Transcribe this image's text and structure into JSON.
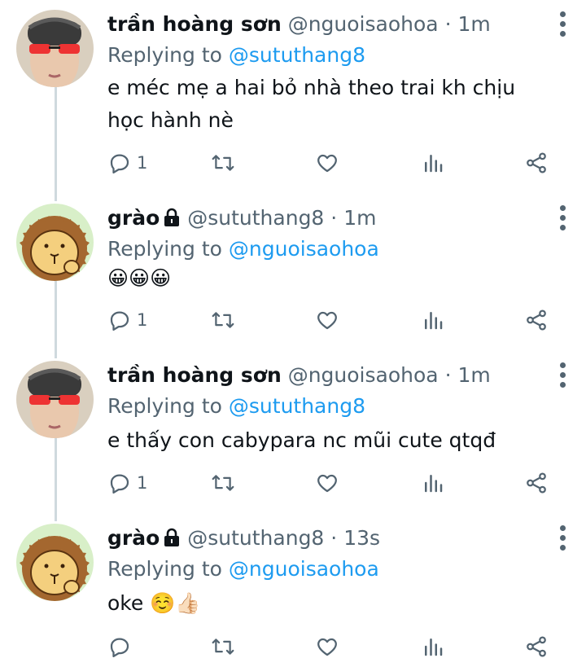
{
  "tweets": [
    {
      "name": "trần hoàng sơn",
      "handle": "@nguoisaohoa",
      "time": "1m",
      "locked": false,
      "reply_prefix": "Replying to ",
      "reply_to": "@sututhang8",
      "text": "e méc mẹ a hai bỏ nhà theo trai kh chịu học hành nè",
      "reply_count": "1",
      "avatar": "person-avatar"
    },
    {
      "name": "grào",
      "handle": "@sututhang8",
      "time": "1m",
      "locked": true,
      "reply_prefix": "Replying to ",
      "reply_to": "@nguoisaohoa",
      "text": "😀😀😀",
      "reply_count": "1",
      "avatar": "capybara-avatar"
    },
    {
      "name": "trần hoàng sơn",
      "handle": "@nguoisaohoa",
      "time": "1m",
      "locked": false,
      "reply_prefix": "Replying to ",
      "reply_to": "@sututhang8",
      "text": "e thấy con cabypara nc mũi cute qtqđ",
      "reply_count": "1",
      "avatar": "person-avatar"
    },
    {
      "name": "grào",
      "handle": "@sututhang8",
      "time": "13s",
      "locked": true,
      "reply_prefix": "Replying to ",
      "reply_to": "@nguoisaohoa",
      "text": "oke ☺️👍🏻",
      "reply_count": "",
      "avatar": "capybara-avatar"
    }
  ],
  "separator": "·",
  "colors": {
    "text": "#0f1419",
    "muted": "#536471",
    "link": "#1d9bf0",
    "thread": "#cfd9de"
  }
}
